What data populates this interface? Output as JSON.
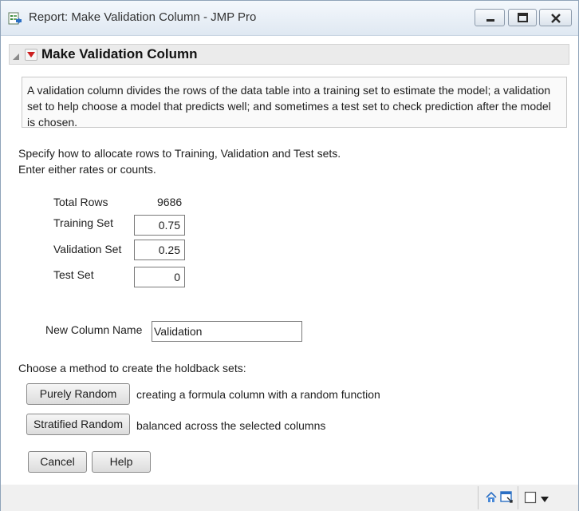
{
  "window": {
    "title": "Report: Make Validation Column - JMP Pro"
  },
  "report": {
    "title": "Make Validation Column",
    "description": "A validation column divides the rows of the data table into a training set to estimate the model; a validation set to help choose a model that predicts well; and sometimes a test set to check prediction after the model is chosen.",
    "instruction_line1": "Specify how to allocate rows to Training, Validation and Test sets.",
    "instruction_line2": "Enter either rates or counts."
  },
  "allocation": {
    "total_rows_label": "Total Rows",
    "total_rows_value": "9686",
    "training_label": "Training Set",
    "training_value": "0.75",
    "validation_label": "Validation Set",
    "validation_value": "0.25",
    "test_label": "Test Set",
    "test_value": "0"
  },
  "new_column": {
    "label": "New Column Name",
    "value": "Validation"
  },
  "method": {
    "prompt": "Choose a method to create the holdback sets:",
    "purely_random_label": "Purely Random",
    "purely_random_desc": "creating a formula column with a random function",
    "stratified_random_label": "Stratified Random",
    "stratified_random_desc": "balanced across the selected columns"
  },
  "actions": {
    "cancel_label": "Cancel",
    "help_label": "Help"
  },
  "icons": {
    "app": "jmp-report-icon",
    "outline_menu": "red-triangle-menu-icon",
    "disclosure": "disclosure-triangle-icon",
    "status_home": "home-icon",
    "status_tile": "window-tile-icon",
    "status_square": "window-square-icon",
    "status_dropdown": "dropdown-arrow-icon"
  },
  "colors": {
    "red_triangle": "#cc1f1f",
    "titlebar_top": "#f4f8fc",
    "titlebar_bottom": "#dfe8f2"
  }
}
